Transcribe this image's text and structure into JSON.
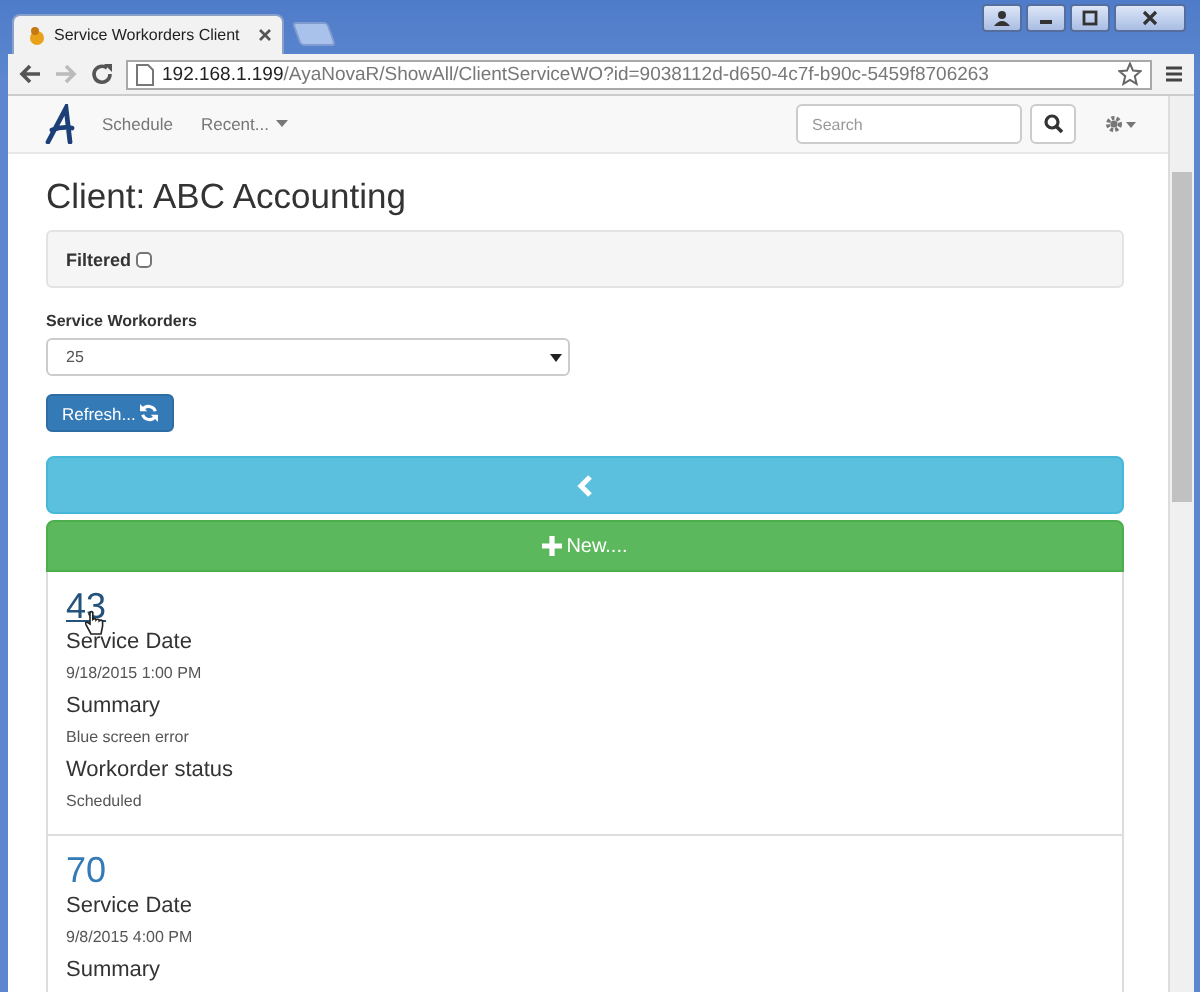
{
  "browser": {
    "tabs": [
      {
        "label": "Service Workorders Client",
        "selected": true
      },
      {
        "kind": "new",
        "selected": false
      }
    ],
    "address": {
      "host": "192.168.1.199",
      "path": "/AyaNovaR/ShowAll/ClientServiceWO?id=9038112d-d650-4c7f-b90c-5459f8706263"
    }
  },
  "navbar": {
    "links": [
      {
        "label": "Schedule",
        "dropdown": false
      },
      {
        "label": "Recent...",
        "dropdown": true
      }
    ],
    "search": {
      "placeholder": "Search"
    }
  },
  "title": "Client: ABC Accounting",
  "filter": {
    "label": "Filtered",
    "checked": false
  },
  "select": {
    "label": "Service Workorders",
    "value": "25"
  },
  "refresh_button": "Refresh...",
  "new_button": "New....",
  "workorders": [
    {
      "number": "43",
      "hovered": true,
      "fields": [
        {
          "label": "Service Date",
          "value": "9/18/2015 1:00 PM"
        },
        {
          "label": "Summary",
          "value": "Blue screen error"
        },
        {
          "label": "Workorder status",
          "value": "Scheduled"
        }
      ]
    },
    {
      "number": "70",
      "hovered": false,
      "fields": [
        {
          "label": "Service Date",
          "value": "9/8/2015 4:00 PM"
        },
        {
          "label": "Summary"
        }
      ]
    }
  ]
}
